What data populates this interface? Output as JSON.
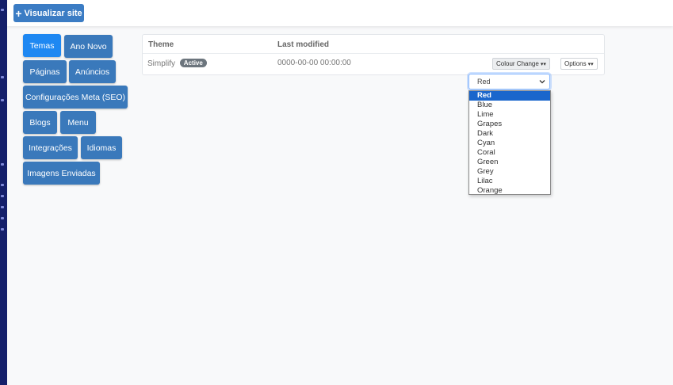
{
  "toolbar": {
    "visit_site_label": "Visualizar site"
  },
  "nav": [
    {
      "label": "Temas",
      "active": true
    },
    {
      "label": "Ano Novo"
    },
    {
      "label": "Páginas"
    },
    {
      "label": "Anúncios"
    },
    {
      "label": "Configurações Meta (SEO)"
    },
    {
      "label": "Blogs"
    },
    {
      "label": "Menu"
    },
    {
      "label": "Integrações"
    },
    {
      "label": "Idiomas"
    },
    {
      "label": "Imagens Enviadas"
    }
  ],
  "themes_table": {
    "headers": {
      "theme": "Theme",
      "last_modified": "Last modified"
    },
    "row": {
      "name": "Simplify",
      "badge": "Active",
      "last_modified": "0000-00-00 00:00:00",
      "colour_button": "Colour Change",
      "options_button": "Options"
    }
  },
  "colour_select": {
    "value": "Red",
    "options": [
      "Red",
      "Blue",
      "Lime",
      "Grapes",
      "Dark",
      "Cyan",
      "Coral",
      "Green",
      "Grey",
      "Lilac",
      "Orange"
    ],
    "selected_index": 0
  },
  "colors": {
    "primary": "#3a79bb",
    "active": "#1e88f2",
    "sidebar": "#15206a"
  }
}
